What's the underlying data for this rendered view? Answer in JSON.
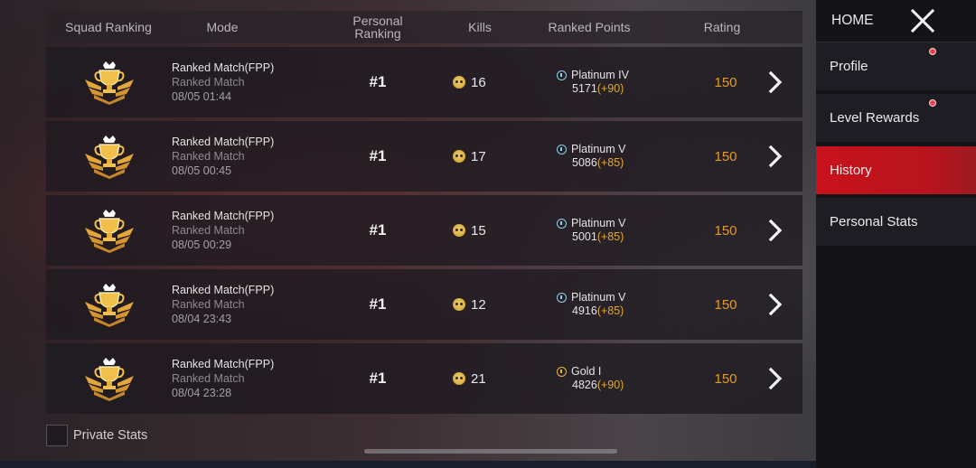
{
  "header": {
    "squad_ranking": "Squad Ranking",
    "mode": "Mode",
    "personal_ranking": "Personal Ranking",
    "kills": "Kills",
    "ranked_points": "Ranked Points",
    "rating": "Rating"
  },
  "matches": [
    {
      "mode": "Ranked Match(FPP)",
      "submode": "Ranked Match",
      "time": "08/05 01:44",
      "rank": "#1",
      "kills": "16",
      "tier": "Platinum IV",
      "points": "5171",
      "delta": "(+90)",
      "rating": "150",
      "tier_color": "#8fd0e8"
    },
    {
      "mode": "Ranked Match(FPP)",
      "submode": "Ranked Match",
      "time": "08/05 00:45",
      "rank": "#1",
      "kills": "17",
      "tier": "Platinum V",
      "points": "5086",
      "delta": "(+85)",
      "rating": "150",
      "tier_color": "#8fd0e8"
    },
    {
      "mode": "Ranked Match(FPP)",
      "submode": "Ranked Match",
      "time": "08/05 00:29",
      "rank": "#1",
      "kills": "15",
      "tier": "Platinum V",
      "points": "5001",
      "delta": "(+85)",
      "rating": "150",
      "tier_color": "#8fd0e8"
    },
    {
      "mode": "Ranked Match(FPP)",
      "submode": "Ranked Match",
      "time": "08/04 23:43",
      "rank": "#1",
      "kills": "12",
      "tier": "Platinum V",
      "points": "4916",
      "delta": "(+85)",
      "rating": "150",
      "tier_color": "#8fd0e8"
    },
    {
      "mode": "Ranked Match(FPP)",
      "submode": "Ranked Match",
      "time": "08/04 23:28",
      "rank": "#1",
      "kills": "21",
      "tier": "Gold I",
      "points": "4826",
      "delta": "(+90)",
      "rating": "150",
      "tier_color": "#e6b848"
    }
  ],
  "footer": {
    "private_stats": "Private Stats"
  },
  "sidebar": {
    "home": "HOME",
    "items": [
      {
        "label": "Profile",
        "notification": true
      },
      {
        "label": "Level Rewards",
        "notification": true
      },
      {
        "label": "History",
        "active": true
      },
      {
        "label": "Personal Stats"
      }
    ]
  },
  "colors": {
    "accent_red": "#c8121c",
    "rating_orange": "#e39a2b",
    "delta_gold": "#e2a933"
  }
}
